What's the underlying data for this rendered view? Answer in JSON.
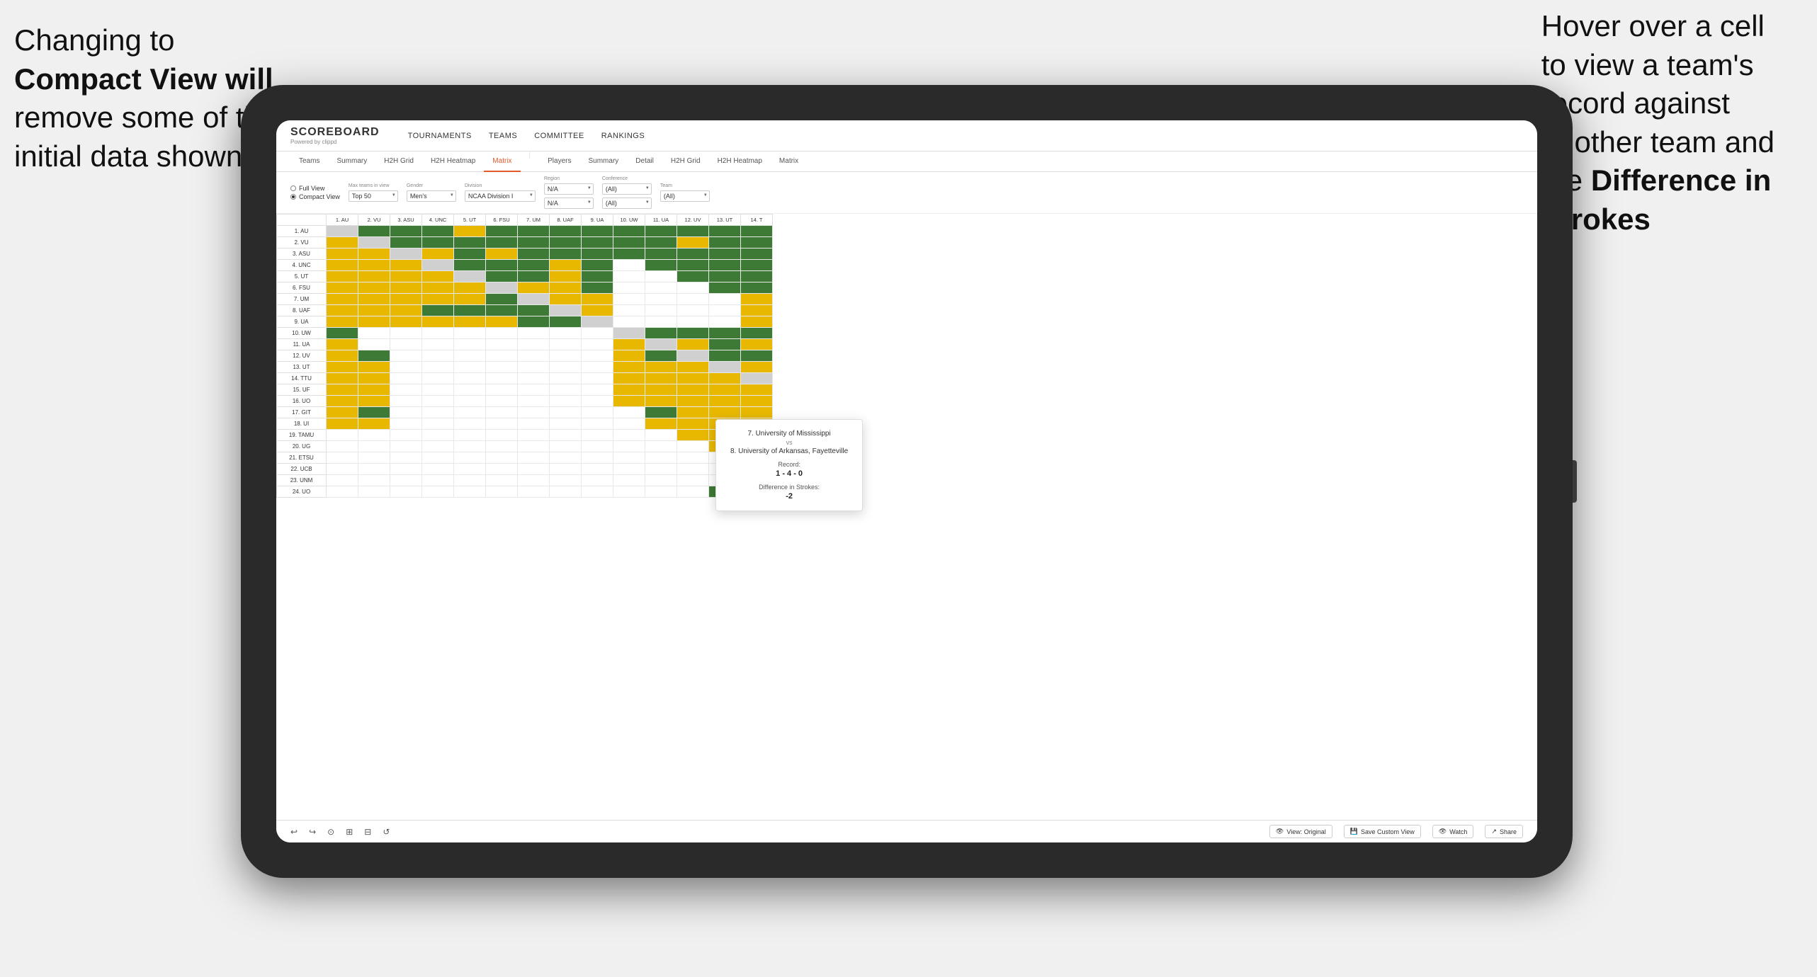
{
  "annotations": {
    "left": {
      "line1": "Changing to",
      "line2": "Compact View will",
      "line3": "remove some of the",
      "line4": "initial data shown"
    },
    "right": {
      "line1": "Hover over a cell",
      "line2": "to view a team's",
      "line3": "record against",
      "line4": "another team and",
      "line5": "the ",
      "line5bold": "Difference in",
      "line6": "Strokes"
    }
  },
  "nav": {
    "logo": "SCOREBOARD",
    "logo_sub": "Powered by clippd",
    "links": [
      "TOURNAMENTS",
      "TEAMS",
      "COMMITTEE",
      "RANKINGS"
    ]
  },
  "sub_tabs": {
    "group1": [
      "Teams",
      "Summary",
      "H2H Grid",
      "H2H Heatmap",
      "Matrix"
    ],
    "group2": [
      "Players",
      "Summary",
      "Detail",
      "H2H Grid",
      "H2H Heatmap",
      "Matrix"
    ],
    "active": "Matrix"
  },
  "filters": {
    "view_options": [
      "Full View",
      "Compact View"
    ],
    "selected_view": "Compact View",
    "max_teams": {
      "label": "Max teams in view",
      "value": "Top 50"
    },
    "gender": {
      "label": "Gender",
      "value": "Men's"
    },
    "division": {
      "label": "Division",
      "value": "NCAA Division I"
    },
    "region": {
      "label": "Region",
      "value": "N/A",
      "value2": "N/A"
    },
    "conference": {
      "label": "Conference",
      "value": "(All)",
      "value2": "(All)"
    },
    "team": {
      "label": "Team",
      "value": "(All)"
    }
  },
  "matrix": {
    "col_headers": [
      "1. AU",
      "2. VU",
      "3. ASU",
      "4. UNC",
      "5. UT",
      "6. FSU",
      "7. UM",
      "8. UAF",
      "9. UA",
      "10. UW",
      "11. UA",
      "12. UV",
      "13. UT",
      "14. T"
    ],
    "rows": [
      {
        "label": "1. AU",
        "cells": [
          "self",
          "green",
          "green",
          "green",
          "yellow",
          "green",
          "green",
          "green",
          "green",
          "green",
          "green",
          "green",
          "green",
          "green"
        ]
      },
      {
        "label": "2. VU",
        "cells": [
          "yellow",
          "self",
          "green",
          "green",
          "green",
          "green",
          "green",
          "green",
          "green",
          "green",
          "green",
          "yellow",
          "green",
          "green"
        ]
      },
      {
        "label": "3. ASU",
        "cells": [
          "yellow",
          "yellow",
          "self",
          "yellow",
          "green",
          "yellow",
          "green",
          "green",
          "green",
          "green",
          "green",
          "green",
          "green",
          "green"
        ]
      },
      {
        "label": "4. UNC",
        "cells": [
          "yellow",
          "yellow",
          "yellow",
          "self",
          "green",
          "green",
          "green",
          "yellow",
          "green",
          "white",
          "green",
          "green",
          "green",
          "green"
        ]
      },
      {
        "label": "5. UT",
        "cells": [
          "yellow",
          "yellow",
          "yellow",
          "yellow",
          "self",
          "green",
          "green",
          "yellow",
          "green",
          "white",
          "white",
          "green",
          "green",
          "green"
        ]
      },
      {
        "label": "6. FSU",
        "cells": [
          "yellow",
          "yellow",
          "yellow",
          "yellow",
          "yellow",
          "self",
          "yellow",
          "yellow",
          "green",
          "white",
          "white",
          "white",
          "green",
          "green"
        ]
      },
      {
        "label": "7. UM",
        "cells": [
          "yellow",
          "yellow",
          "yellow",
          "yellow",
          "yellow",
          "green",
          "self",
          "yellow",
          "yellow",
          "white",
          "white",
          "white",
          "white",
          "yellow"
        ]
      },
      {
        "label": "8. UAF",
        "cells": [
          "yellow",
          "yellow",
          "yellow",
          "green",
          "green",
          "green",
          "green",
          "self",
          "yellow",
          "white",
          "white",
          "white",
          "white",
          "yellow"
        ]
      },
      {
        "label": "9. UA",
        "cells": [
          "yellow",
          "yellow",
          "yellow",
          "yellow",
          "yellow",
          "yellow",
          "green",
          "green",
          "self",
          "white",
          "white",
          "white",
          "white",
          "yellow"
        ]
      },
      {
        "label": "10. UW",
        "cells": [
          "green",
          "white",
          "white",
          "white",
          "white",
          "white",
          "white",
          "white",
          "white",
          "self",
          "green",
          "green",
          "green",
          "green"
        ]
      },
      {
        "label": "11. UA",
        "cells": [
          "yellow",
          "white",
          "white",
          "white",
          "white",
          "white",
          "white",
          "white",
          "white",
          "yellow",
          "self",
          "yellow",
          "green",
          "yellow"
        ]
      },
      {
        "label": "12. UV",
        "cells": [
          "yellow",
          "green",
          "white",
          "white",
          "white",
          "white",
          "white",
          "white",
          "white",
          "yellow",
          "green",
          "self",
          "green",
          "green"
        ]
      },
      {
        "label": "13. UT",
        "cells": [
          "yellow",
          "yellow",
          "white",
          "white",
          "white",
          "white",
          "white",
          "white",
          "white",
          "yellow",
          "yellow",
          "yellow",
          "self",
          "yellow"
        ]
      },
      {
        "label": "14. TTU",
        "cells": [
          "yellow",
          "yellow",
          "white",
          "white",
          "white",
          "white",
          "white",
          "white",
          "white",
          "yellow",
          "yellow",
          "yellow",
          "yellow",
          "self"
        ]
      },
      {
        "label": "15. UF",
        "cells": [
          "yellow",
          "yellow",
          "white",
          "white",
          "white",
          "white",
          "white",
          "white",
          "white",
          "yellow",
          "yellow",
          "yellow",
          "yellow",
          "yellow"
        ]
      },
      {
        "label": "16. UO",
        "cells": [
          "yellow",
          "yellow",
          "white",
          "white",
          "white",
          "white",
          "white",
          "white",
          "white",
          "yellow",
          "yellow",
          "yellow",
          "yellow",
          "yellow"
        ]
      },
      {
        "label": "17. GIT",
        "cells": [
          "yellow",
          "green",
          "white",
          "white",
          "white",
          "white",
          "white",
          "white",
          "white",
          "white",
          "green",
          "yellow",
          "yellow",
          "yellow"
        ]
      },
      {
        "label": "18. UI",
        "cells": [
          "yellow",
          "yellow",
          "white",
          "white",
          "white",
          "white",
          "white",
          "white",
          "white",
          "white",
          "yellow",
          "yellow",
          "yellow",
          "yellow"
        ]
      },
      {
        "label": "19. TAMU",
        "cells": [
          "white",
          "white",
          "white",
          "white",
          "white",
          "white",
          "white",
          "white",
          "white",
          "white",
          "white",
          "yellow",
          "yellow",
          "yellow"
        ]
      },
      {
        "label": "20. UG",
        "cells": [
          "white",
          "white",
          "white",
          "white",
          "white",
          "white",
          "white",
          "white",
          "white",
          "white",
          "white",
          "white",
          "yellow",
          "yellow"
        ]
      },
      {
        "label": "21. ETSU",
        "cells": [
          "white",
          "white",
          "white",
          "white",
          "white",
          "white",
          "white",
          "white",
          "white",
          "white",
          "white",
          "white",
          "white",
          "yellow"
        ]
      },
      {
        "label": "22. UCB",
        "cells": [
          "white",
          "white",
          "white",
          "white",
          "white",
          "white",
          "white",
          "white",
          "white",
          "white",
          "white",
          "white",
          "white",
          "yellow"
        ]
      },
      {
        "label": "23. UNM",
        "cells": [
          "white",
          "white",
          "white",
          "white",
          "white",
          "white",
          "white",
          "white",
          "white",
          "white",
          "white",
          "white",
          "white",
          "yellow"
        ]
      },
      {
        "label": "24. UO",
        "cells": [
          "white",
          "white",
          "white",
          "white",
          "white",
          "white",
          "white",
          "white",
          "white",
          "white",
          "white",
          "white",
          "green",
          "yellow"
        ]
      }
    ]
  },
  "tooltip": {
    "team1": "7. University of Mississippi",
    "vs": "vs",
    "team2": "8. University of Arkansas, Fayetteville",
    "record_label": "Record:",
    "record": "1 - 4 - 0",
    "diff_label": "Difference in Strokes:",
    "diff": "-2"
  },
  "toolbar": {
    "icons": [
      "↩",
      "↪",
      "⊙",
      "⊞",
      "⊟",
      "↺"
    ],
    "view_btn": "View: Original",
    "save_btn": "Save Custom View",
    "watch_btn": "Watch",
    "share_btn": "Share"
  }
}
